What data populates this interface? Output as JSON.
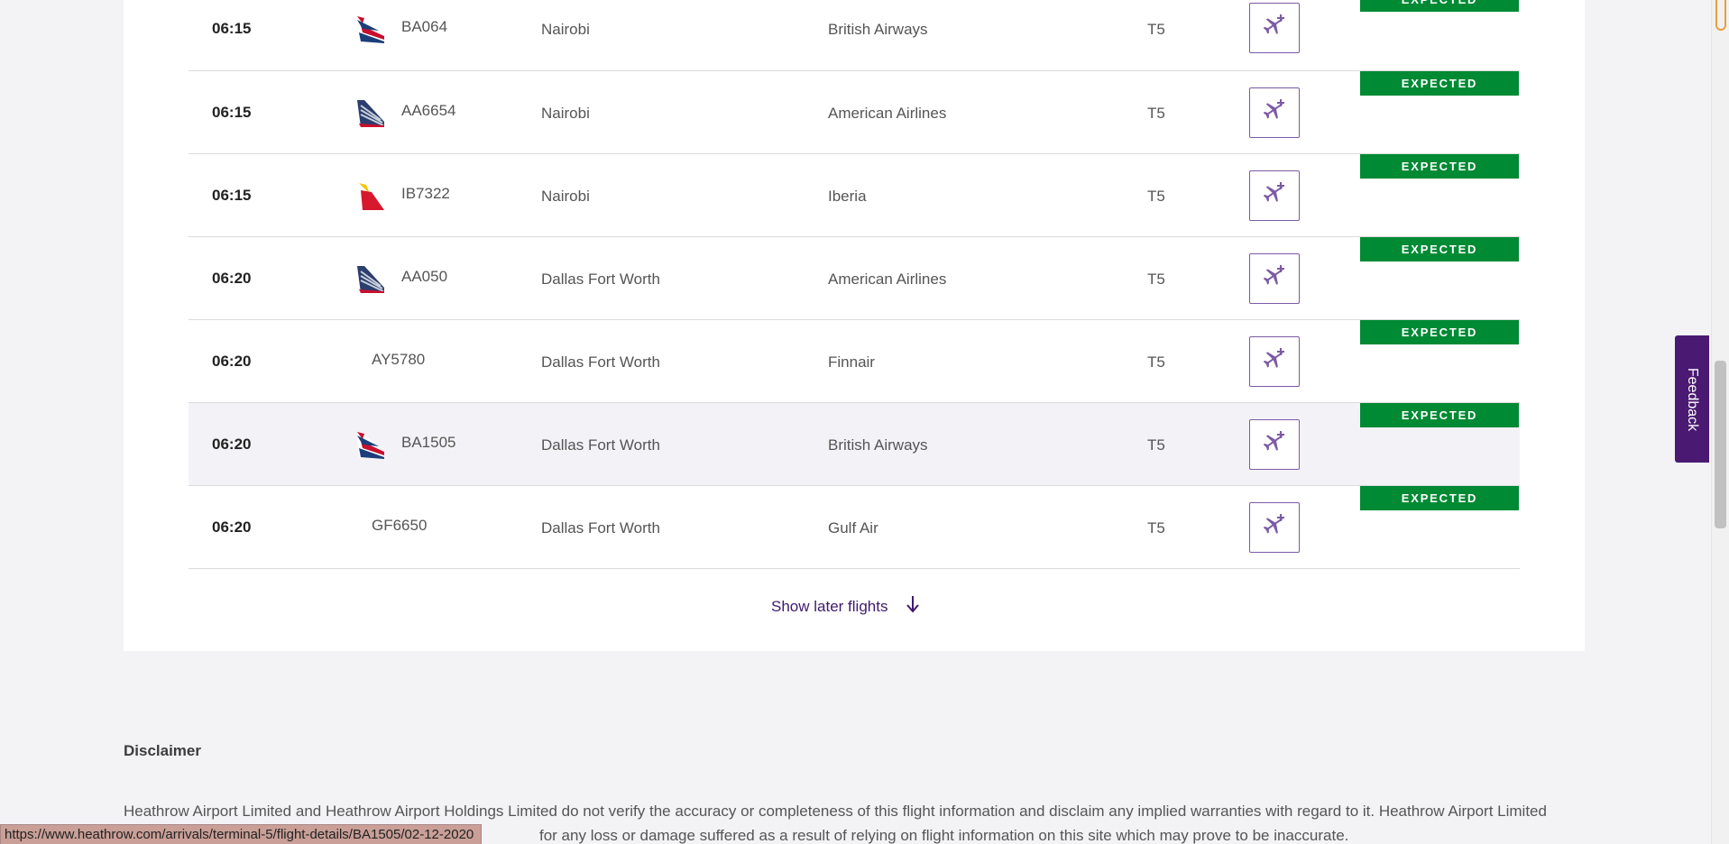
{
  "flights": [
    {
      "time": "06:15",
      "logo": "british-airways-logo",
      "flight": "BA064",
      "origin": "Nairobi",
      "airline": "British Airways",
      "terminal": "T5",
      "status": "EXPECTED"
    },
    {
      "time": "06:15",
      "logo": "american-airlines-logo",
      "flight": "AA6654",
      "origin": "Nairobi",
      "airline": "American Airlines",
      "terminal": "T5",
      "status": "EXPECTED"
    },
    {
      "time": "06:15",
      "logo": "iberia-logo",
      "flight": "IB7322",
      "origin": "Nairobi",
      "airline": "Iberia",
      "terminal": "T5",
      "status": "EXPECTED"
    },
    {
      "time": "06:20",
      "logo": "american-airlines-logo",
      "flight": "AA050",
      "origin": "Dallas Fort Worth",
      "airline": "American Airlines",
      "terminal": "T5",
      "status": "EXPECTED"
    },
    {
      "time": "06:20",
      "logo": "",
      "flight": "AY5780",
      "origin": "Dallas Fort Worth",
      "airline": "Finnair",
      "terminal": "T5",
      "status": "EXPECTED"
    },
    {
      "time": "06:20",
      "logo": "british-airways-logo",
      "flight": "BA1505",
      "origin": "Dallas Fort Worth",
      "airline": "British Airways",
      "terminal": "T5",
      "status": "EXPECTED"
    },
    {
      "time": "06:20",
      "logo": "",
      "flight": "GF6650",
      "origin": "Dallas Fort Worth",
      "airline": "Gulf Air",
      "terminal": "T5",
      "status": "EXPECTED"
    }
  ],
  "show_later": {
    "label": "Show later flights",
    "icon": "arrow-down-icon"
  },
  "disclaimer": {
    "title": "Disclaimer",
    "text_line1": "Heathrow Airport Limited and Heathrow Airport Holdings Limited do not verify the accuracy or completeness of this flight information and disclaim any implied warranties with regard to it. Heathrow Airport Limited",
    "text_line2": "for any loss or damage suffered as a result of relying on flight information on this site which may prove to be inaccurate."
  },
  "status_bar_url": "https://www.heathrow.com/arrivals/terminal-5/flight-details/BA1505/02-12-2020",
  "feedback_label": "Feedback",
  "colors": {
    "status_green": "#008a34",
    "brand_purple": "#4a1a73",
    "button_border": "#7b5aa6",
    "card_bg": "#ffffff",
    "page_bg": "#f3f3f6"
  }
}
